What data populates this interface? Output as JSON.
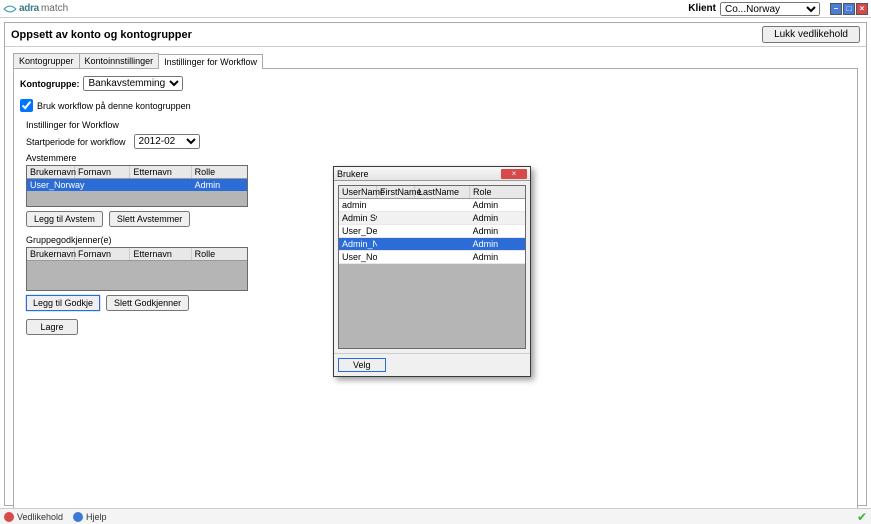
{
  "topbar": {
    "logo_main": "adra",
    "logo_sub": "match",
    "klient_label": "Klient",
    "klient_selected": "Co...Norway"
  },
  "main": {
    "title": "Oppsett av konto og kontogrupper",
    "close_label": "Lukk vedlikehold"
  },
  "tabs": {
    "kontogrupper": "Kontogrupper",
    "kontoinnstillinger": "Kontoinnstillinger",
    "instillinger": "Instillinger for Workflow"
  },
  "panel": {
    "kontogruppe_label": "Kontogruppe:",
    "kontogruppe_value": "Bankavstemming",
    "chk_label": "Bruk workflow på denne kontogruppen",
    "chk_checked": true,
    "subhead": "Instillinger for Workflow",
    "startperiode_label": "Startperiode for workflow",
    "startperiode_value": "2012-02",
    "avstemmere_label": "Avstemmere",
    "gruppe_label": "Gruppegodkjenner(e)"
  },
  "grid_headers": {
    "brukernavn": "Brukernavn",
    "fornavn": "Fornavn",
    "etternavn": "Etternavn",
    "rolle": "Rolle"
  },
  "avstemmere": [
    {
      "brukernavn": "User_Norway",
      "fornavn": "",
      "etternavn": "",
      "rolle": "Admin"
    }
  ],
  "godkjennere": [],
  "buttons": {
    "legg_til_avstem": "Legg til Avstem",
    "slett_avstemmer": "Slett Avstemmer",
    "legg_til_godkje": "Legg til Godkje",
    "slett_godkjenner": "Slett Godkjenner",
    "lagre": "Lagre"
  },
  "dialog": {
    "title": "Brukere",
    "headers": {
      "un": "UserName",
      "fn": "FirstName",
      "ln": "LastName",
      "rl": "Role"
    },
    "rows": [
      {
        "un": "admin",
        "fn": "",
        "ln": "",
        "rl": "Admin",
        "sel": false,
        "alt": false
      },
      {
        "un": "Admin Swe...",
        "fn": "",
        "ln": "",
        "rl": "Admin",
        "sel": false,
        "alt": true
      },
      {
        "un": "User_Den...",
        "fn": "",
        "ln": "",
        "rl": "Admin",
        "sel": false,
        "alt": false
      },
      {
        "un": "Admin_Nor...",
        "fn": "",
        "ln": "",
        "rl": "Admin",
        "sel": true,
        "alt": true
      },
      {
        "un": "User_Norw...",
        "fn": "",
        "ln": "",
        "rl": "Admin",
        "sel": false,
        "alt": false
      }
    ],
    "velg": "Velg"
  },
  "status": {
    "vedlikehold": "Vedlikehold",
    "hjelp": "Hjelp"
  }
}
